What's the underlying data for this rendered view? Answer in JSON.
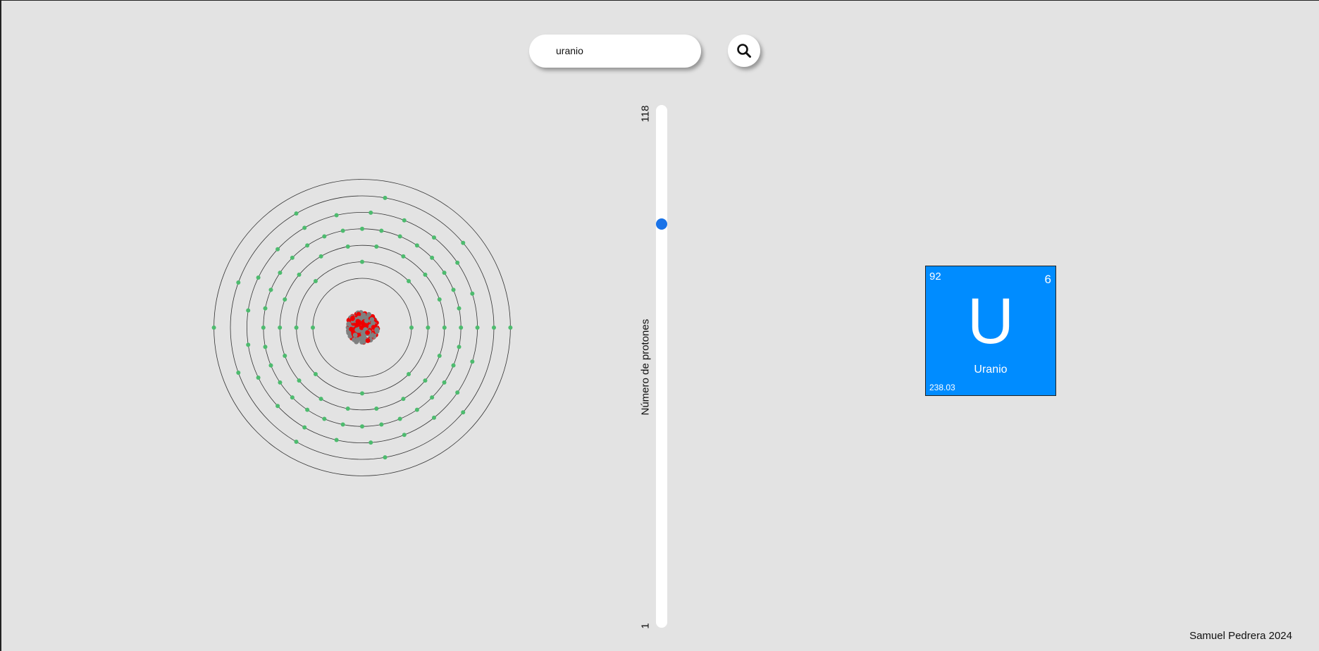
{
  "search": {
    "value": "uranio",
    "placeholder": ""
  },
  "slider": {
    "max_label": "118",
    "min_label": "1",
    "label": "Número de protones",
    "min": 1,
    "max": 118,
    "value": 92,
    "thumb_color": "#1a73e8"
  },
  "element": {
    "atomic_number": "92",
    "period": "6",
    "symbol": "U",
    "name": "Uranio",
    "mass": "238.03",
    "color": "#008cff"
  },
  "atom": {
    "shell_electrons": [
      2,
      8,
      18,
      32,
      21,
      9,
      2
    ],
    "electron_color": "#4dbb6e",
    "proton_color": "#ee0000",
    "neutron_color": "#808080"
  },
  "footer": {
    "credit": "Samuel Pedrera 2024"
  },
  "icons": {
    "search_button": "search-icon"
  }
}
